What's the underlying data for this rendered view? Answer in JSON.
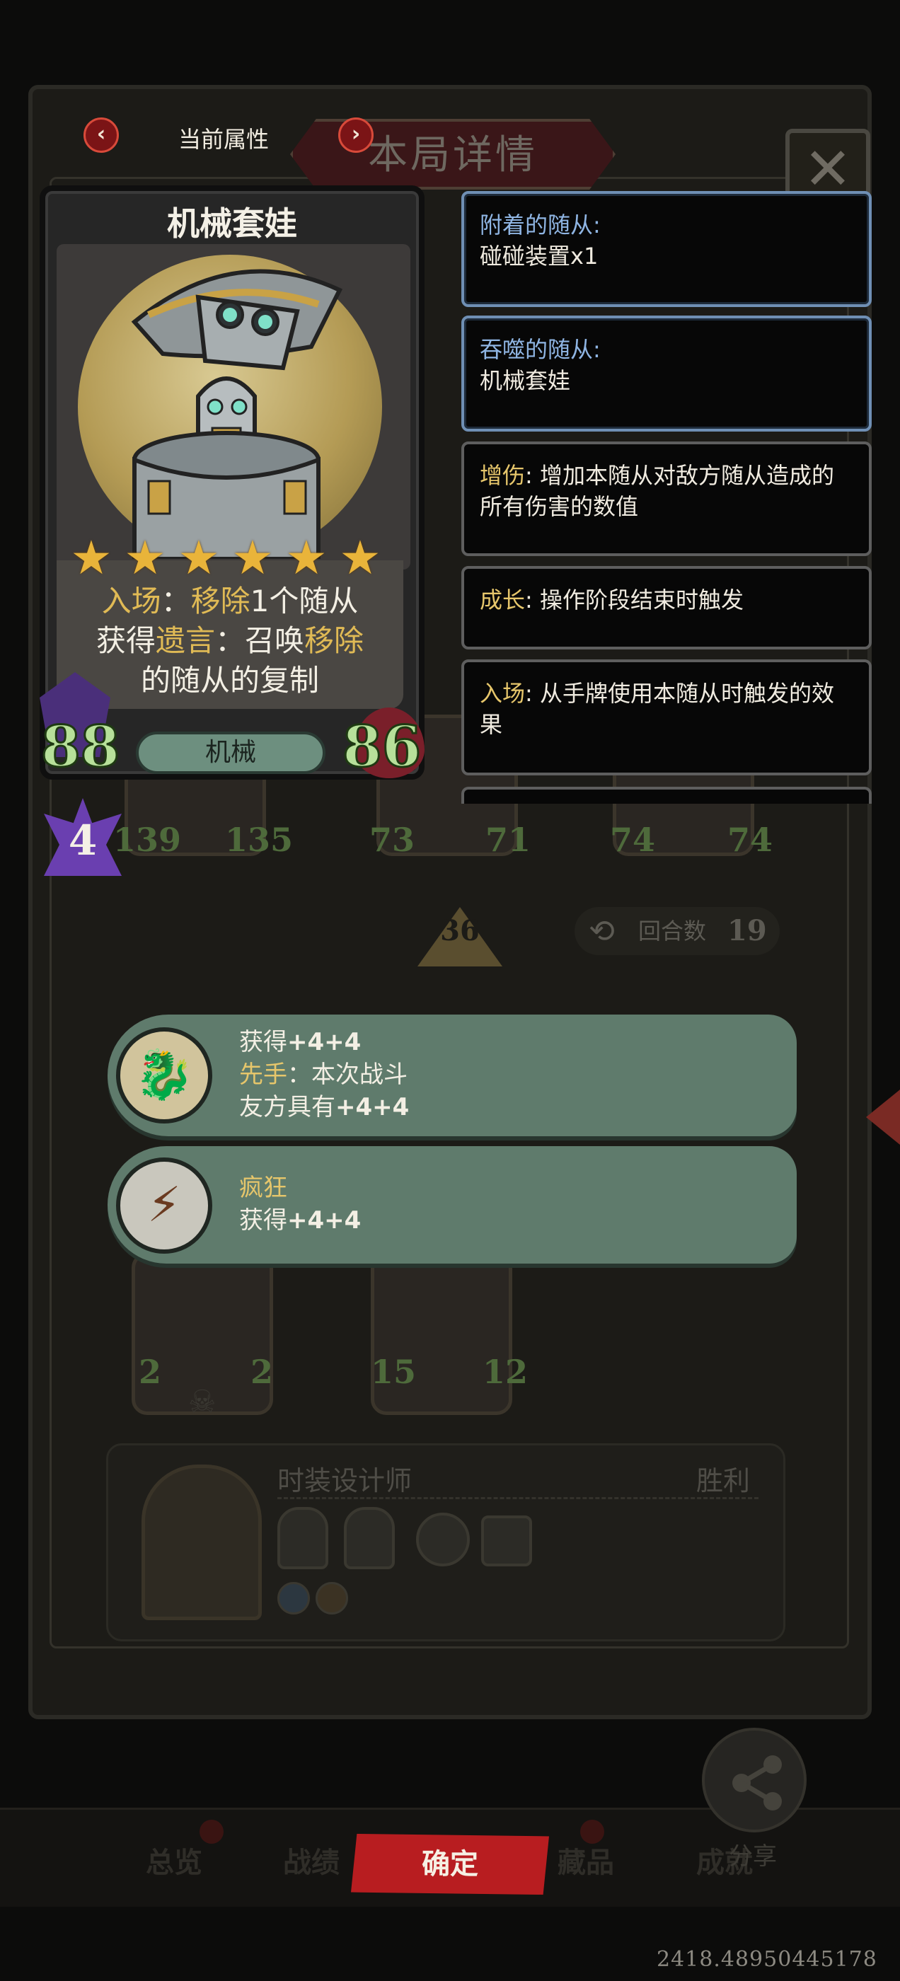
{
  "background": {
    "title": "本局详情",
    "close_glyph": "✕",
    "round_label": "回合数",
    "round_count": "19",
    "tavern_tier": "36",
    "board_stats": [
      {
        "atk": "139",
        "hp": "135"
      },
      {
        "atk": "73",
        "hp": "71"
      },
      {
        "atk": "74",
        "hp": "74"
      }
    ],
    "lower_stats": [
      {
        "atk": "2",
        "hp": "2"
      },
      {
        "atk": "15",
        "hp": "12"
      }
    ],
    "opponent": {
      "name": "时装设计师",
      "result": "胜利"
    },
    "nav_tabs": [
      "总览",
      "战绩",
      "藏品",
      "成就"
    ],
    "confirm_label": "确定",
    "share_label": "分享",
    "coords_readout": "2418.48950445178"
  },
  "card_nav": {
    "label": "当前属性",
    "prev_glyph": "‹",
    "next_glyph": "›"
  },
  "card": {
    "name": "机械套娃",
    "stars": 6,
    "desc_line1_kw": "入场",
    "desc_line1_sep": "：",
    "desc_line1_kw2": "移除",
    "desc_line1_rest": "1个随从",
    "desc_line2_pre": "获得",
    "desc_line2_kw": "遗言",
    "desc_line2_mid": "：召唤",
    "desc_line2_kw2": "移除",
    "desc_line3": "的随从的复制",
    "attack": "88",
    "health": "86",
    "tribe": "机械",
    "tier": "4"
  },
  "info_boxes": {
    "attached_title": "附着的随从:",
    "attached_value": "碰碰装置x1",
    "devoured_title": "吞噬的随从:",
    "devoured_value": "机械套娃",
    "buff_kw": "增伤",
    "buff_text": ": 增加本随从对敌方随从造成的所有伤害的数值",
    "growth_kw": "成长",
    "growth_text": ": 操作阶段结束时触发",
    "entry_kw": "入场",
    "entry_text": ": 从手牌使用本随从时触发的效果"
  },
  "banners": [
    {
      "icon": "dragon-medallion",
      "line1_pre": "获得",
      "line1_bold": "+4+4",
      "line2_kw": "先手",
      "line2_rest": "：本次战斗",
      "line3_pre": "友方具有",
      "line3_bold": "+4+4"
    },
    {
      "icon": "lightning-shield",
      "line1_kw": "疯狂",
      "line2_pre": "获得",
      "line2_bold": "+4+4"
    }
  ],
  "colors": {
    "keyword": "#e0ba55",
    "info_title_blue": "#8fb5e3",
    "banner_bg": "#5f7b6c",
    "confirm_red": "#b81d20",
    "stat_green": "#b7e09a"
  }
}
